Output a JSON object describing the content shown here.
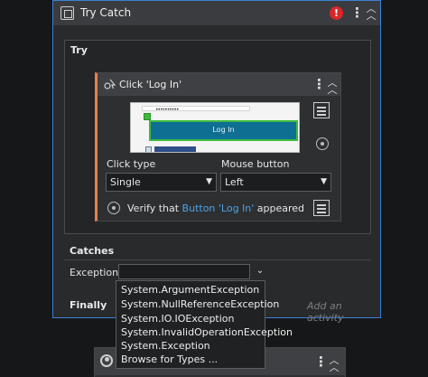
{
  "try_catch": {
    "title": "Try Catch",
    "error_badge": "!",
    "kebab": "⋮",
    "collapse": "⌃⌃"
  },
  "try_section": {
    "label": "Try"
  },
  "click_activity": {
    "title": "Click 'Log In'",
    "preview": {
      "password_dots": "••••••••••",
      "button_label": "Log In"
    },
    "click_type_label": "Click type",
    "click_type_value": "Single",
    "mouse_button_label": "Mouse button",
    "mouse_button_value": "Left",
    "verify": {
      "prefix": "Verify that",
      "target": "Button 'Log In'",
      "suffix": "appeared"
    }
  },
  "catches": {
    "label": "Catches",
    "exception_label": "Exception",
    "exception_value": ""
  },
  "finally": {
    "label": "Finally",
    "placeholder": "Add an activity"
  },
  "exception_dropdown": {
    "options": [
      "System.ArgumentException",
      "System.NullReferenceException",
      "System.IO.IOException",
      "System.InvalidOperationException",
      "System.Exception",
      "Browse for Types ..."
    ]
  },
  "colors": {
    "accent_border": "#3c7fd6",
    "activity_accent": "#e8804c",
    "error": "#d9262a",
    "link": "#4da3e8",
    "preview_button": "#0f6f92",
    "preview_highlight": "#3dba3d"
  }
}
